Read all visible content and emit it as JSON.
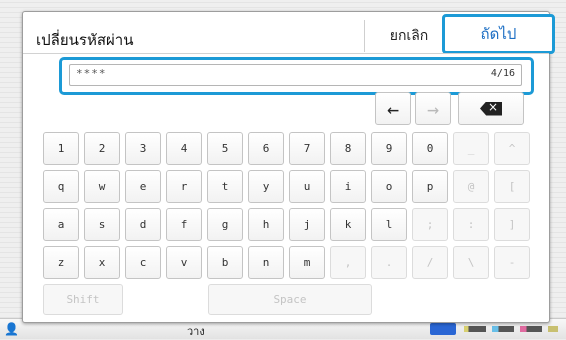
{
  "dialog": {
    "title": "เปลี่ยนรหัสผ่าน",
    "cancel_label": "ยกเลิก",
    "next_label": "ถัดไป"
  },
  "input": {
    "value": "****",
    "counter": "4/16"
  },
  "nav": {
    "left_arrow": "←",
    "right_arrow": "→",
    "backspace": "×"
  },
  "keyboard": {
    "row1": [
      "1",
      "2",
      "3",
      "4",
      "5",
      "6",
      "7",
      "8",
      "9",
      "0",
      "_",
      "^"
    ],
    "row2": [
      "q",
      "w",
      "e",
      "r",
      "t",
      "y",
      "u",
      "i",
      "o",
      "p",
      "@",
      "["
    ],
    "row3": [
      "a",
      "s",
      "d",
      "f",
      "g",
      "h",
      "j",
      "k",
      "l",
      ";",
      ":",
      "]"
    ],
    "row4": [
      "z",
      "x",
      "c",
      "v",
      "b",
      "n",
      "m",
      ",",
      ".",
      "/",
      "\\",
      "-"
    ],
    "shift": "Shift",
    "space": "Space"
  },
  "background": {
    "bottom_text": "วาง",
    "person_icon": "👤"
  },
  "colors": {
    "accent": "#1c9ad6",
    "next_text": "#1d6fc4"
  }
}
